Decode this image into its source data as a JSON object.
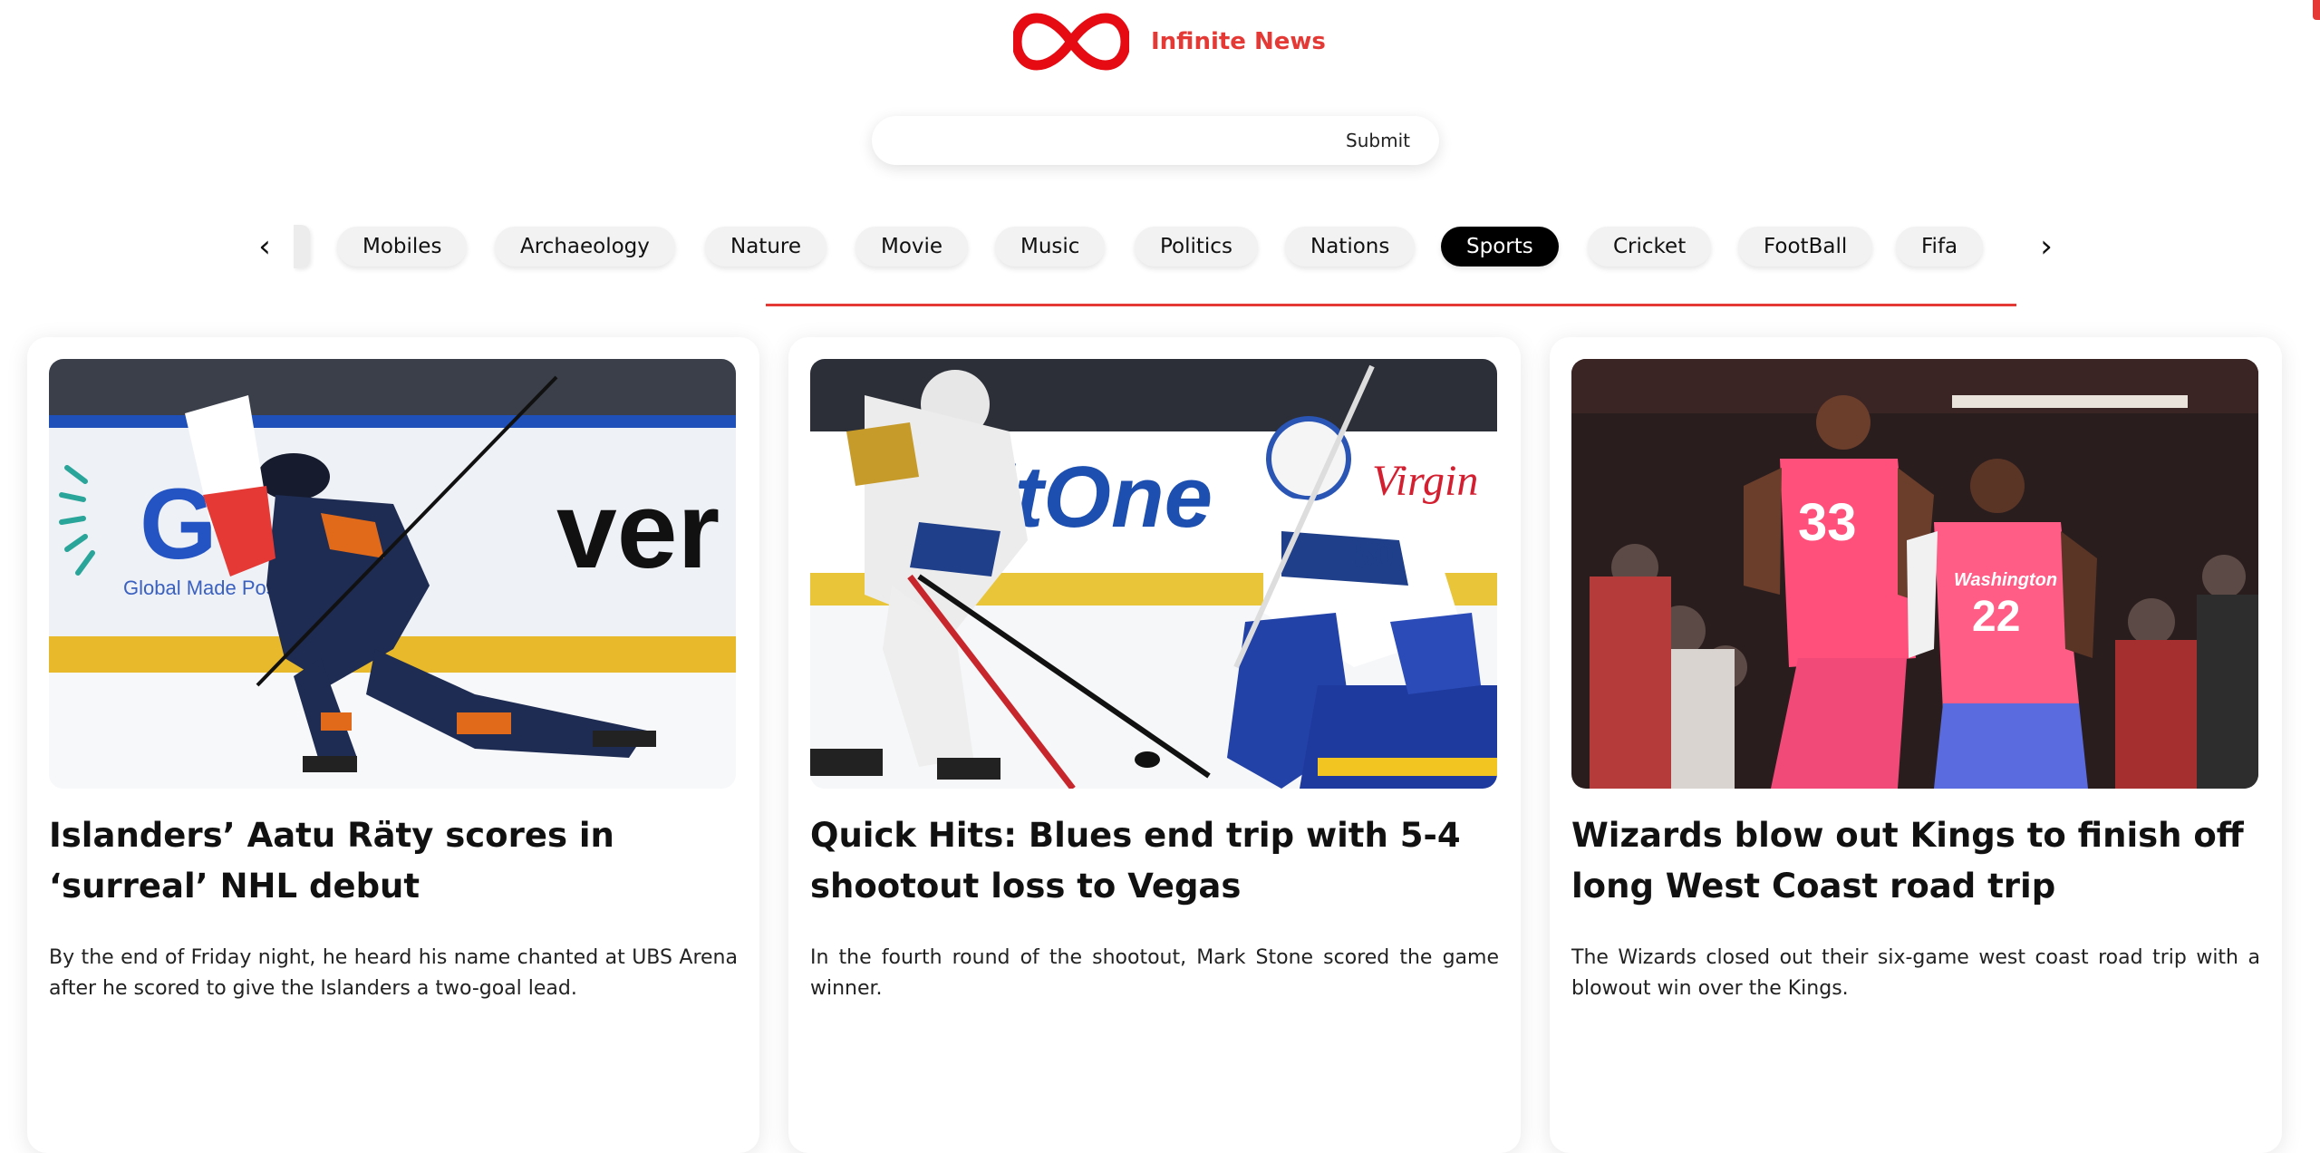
{
  "brand": {
    "name": "Infinite News",
    "logo_icon": "infinity-icon",
    "color": "#e53935"
  },
  "search": {
    "placeholder": "",
    "value": "",
    "submit_label": "Submit"
  },
  "categories": {
    "prev_icon": "chevron-left-icon",
    "next_icon": "chevron-right-icon",
    "items": [
      "Mobiles",
      "Archaeology",
      "Nature",
      "Movie",
      "Music",
      "Politics",
      "Nations",
      "Sports",
      "Cricket",
      "FootBall",
      "Fifa"
    ],
    "active": "Sports"
  },
  "articles": [
    {
      "title": "Islanders’ Aatu Räty scores in ‘surreal’ NHL debut",
      "summary": "By the end of Friday night, he heard his name chanted at UBS Arena after he scored to give the Islanders a two-goal lead.",
      "image_text": "Global Made Possible"
    },
    {
      "title": "Quick Hits: Blues end trip with 5-4 shootout loss to Vegas",
      "summary": "In the fourth round of the shootout, Mark Stone scored the game winner.",
      "image_text": "ditOne"
    },
    {
      "title": "Wizards blow out Kings to finish off long West Coast road trip",
      "summary": "The Wizards closed out their six-game west coast road trip with a blowout win over the Kings.",
      "image_text": "Washington"
    }
  ]
}
